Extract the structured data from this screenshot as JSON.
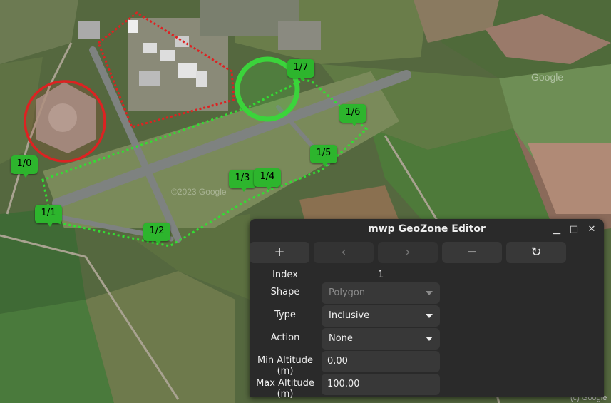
{
  "map": {
    "watermark_google": "Google",
    "watermark_copyright": "©2023 Google",
    "attribution": "(c) Google",
    "zone_colors": {
      "inclusive": "#33cc33",
      "exclusive": "#dd2222"
    },
    "markers": [
      {
        "label": "1/0"
      },
      {
        "label": "1/1"
      },
      {
        "label": "1/2"
      },
      {
        "label": "1/3"
      },
      {
        "label": "1/4"
      },
      {
        "label": "1/5"
      },
      {
        "label": "1/6"
      },
      {
        "label": "1/7"
      }
    ]
  },
  "dialog": {
    "title": "mwp GeoZone Editor",
    "window_controls": {
      "minimize": "▁",
      "maximize": "□",
      "close": "✕"
    },
    "toolbar": {
      "add": "+",
      "prev": "‹",
      "next": "›",
      "remove": "−",
      "refresh": "↻"
    },
    "fields": {
      "index_label": "Index",
      "index_value": "1",
      "shape_label": "Shape",
      "shape_value": "Polygon",
      "type_label": "Type",
      "type_value": "Inclusive",
      "action_label": "Action",
      "action_value": "None",
      "min_alt_label": "Min Altitude (m)",
      "min_alt_value": "0.00",
      "max_alt_label": "Max Altitude (m)",
      "max_alt_value": "100.00"
    }
  }
}
